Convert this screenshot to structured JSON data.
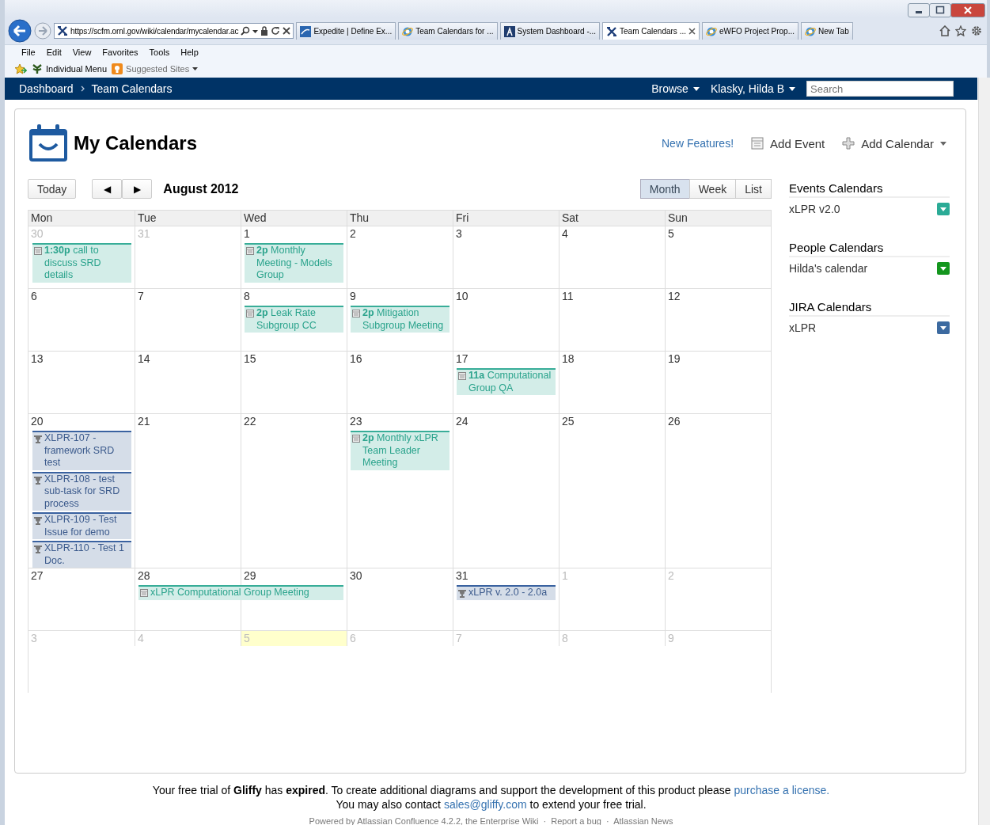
{
  "browser": {
    "address": "https://scfm.ornl.gov/wiki/calendar/mycalendar.ac",
    "tabs": [
      {
        "label": "Expedite | Define Ex...",
        "kind": "site",
        "selected": false
      },
      {
        "label": "Team Calendars for ...",
        "kind": "ie",
        "selected": false
      },
      {
        "label": "System Dashboard -...",
        "kind": "jira",
        "selected": false
      },
      {
        "label": "Team Calendars ...",
        "kind": "tools",
        "selected": true
      },
      {
        "label": "eWFO Project Prop...",
        "kind": "ie",
        "selected": false
      },
      {
        "label": "New Tab",
        "kind": "ie",
        "selected": false
      }
    ],
    "menu": [
      "File",
      "Edit",
      "View",
      "Favorites",
      "Tools",
      "Help"
    ],
    "favorites": [
      {
        "label": "Individual Menu",
        "kind": "leaf"
      },
      {
        "label": "Suggested Sites",
        "kind": "suggested"
      }
    ]
  },
  "nav": {
    "breadcrumbs": [
      "Dashboard",
      "Team Calendars"
    ],
    "browse": "Browse",
    "user": "Klasky, Hilda B",
    "search_placeholder": "Search"
  },
  "header": {
    "title": "My Calendars",
    "new_features": "New Features!",
    "add_event": "Add Event",
    "add_calendar": "Add Calendar"
  },
  "toolbar": {
    "today": "Today",
    "prev": "◀",
    "next": "▶",
    "period": "August 2012",
    "views": [
      {
        "label": "Month",
        "selected": true
      },
      {
        "label": "Week",
        "selected": false
      },
      {
        "label": "List",
        "selected": false
      }
    ]
  },
  "weekdays": [
    "Mon",
    "Tue",
    "Wed",
    "Thu",
    "Fri",
    "Sat",
    "Sun"
  ],
  "weeks": [
    {
      "days": [
        {
          "date": "30",
          "other_month": true,
          "today": false,
          "events": [
            {
              "kind": "event",
              "title": "**1:30p** call to discuss SRD details",
              "continues": false
            }
          ]
        },
        {
          "date": "31",
          "other_month": true,
          "today": false
        },
        {
          "date": "1",
          "other_month": false,
          "today": false,
          "events": [
            {
              "kind": "event",
              "title": "**2p** Monthly Meeting - Models Group",
              "continues": false
            }
          ]
        },
        {
          "date": "2",
          "other_month": false,
          "today": false
        },
        {
          "date": "3",
          "other_month": false,
          "today": false
        },
        {
          "date": "4",
          "other_month": false,
          "today": false
        },
        {
          "date": "5",
          "other_month": false,
          "today": false
        }
      ]
    },
    {
      "days": [
        {
          "date": "6",
          "other_month": false,
          "today": false
        },
        {
          "date": "7",
          "other_month": false,
          "today": false
        },
        {
          "date": "8",
          "other_month": false,
          "today": false,
          "events": [
            {
              "kind": "event",
              "title": "**2p** Leak Rate Subgroup CC",
              "continues": false
            }
          ]
        },
        {
          "date": "9",
          "other_month": false,
          "today": false,
          "events": [
            {
              "kind": "event",
              "title": "**2p** Mitigation Subgroup Meeting",
              "continues": false
            }
          ]
        },
        {
          "date": "10",
          "other_month": false,
          "today": false
        },
        {
          "date": "11",
          "other_month": false,
          "today": false
        },
        {
          "date": "12",
          "other_month": false,
          "today": false
        }
      ]
    },
    {
      "days": [
        {
          "date": "13",
          "other_month": false,
          "today": false
        },
        {
          "date": "14",
          "other_month": false,
          "today": false
        },
        {
          "date": "15",
          "other_month": false,
          "today": false
        },
        {
          "date": "16",
          "other_month": false,
          "today": false
        },
        {
          "date": "17",
          "other_month": false,
          "today": false,
          "events": [
            {
              "kind": "event",
              "title": "**11a** Computational Group QA",
              "continues": false
            }
          ]
        },
        {
          "date": "18",
          "other_month": false,
          "today": false
        },
        {
          "date": "19",
          "other_month": false,
          "today": false
        }
      ]
    },
    {
      "days": [
        {
          "date": "20",
          "other_month": false,
          "today": false,
          "events": [
            {
              "kind": "issue",
              "title": "XLPR-107 - framework SRD test",
              "continues": false
            },
            {
              "kind": "issue",
              "title": "XLPR-108 - test sub-task for SRD process",
              "continues": false
            },
            {
              "kind": "issue",
              "title": "XLPR-109 - Test Issue for demo",
              "continues": false
            },
            {
              "kind": "issue",
              "title": "XLPR-110 - Test 1 Doc.",
              "continues": false
            }
          ]
        },
        {
          "date": "21",
          "other_month": false,
          "today": false
        },
        {
          "date": "22",
          "other_month": false,
          "today": false
        },
        {
          "date": "23",
          "other_month": false,
          "today": false,
          "events": [
            {
              "kind": "event",
              "title": "**2p** Monthly xLPR Team Leader Meeting",
              "continues": false
            }
          ]
        },
        {
          "date": "24",
          "other_month": false,
          "today": false
        },
        {
          "date": "25",
          "other_month": false,
          "today": false
        },
        {
          "date": "26",
          "other_month": false,
          "today": false
        }
      ]
    },
    {
      "days": [
        {
          "date": "27",
          "other_month": false,
          "today": false
        },
        {
          "date": "28",
          "other_month": false,
          "today": false,
          "events": [
            {
              "kind": "event",
              "title": "xLPR Computational Group Meeting",
              "continues": true
            }
          ]
        },
        {
          "date": "29",
          "other_month": false,
          "today": false
        },
        {
          "date": "30",
          "other_month": false,
          "today": false
        },
        {
          "date": "31",
          "other_month": false,
          "today": false,
          "events": [
            {
              "kind": "issue",
              "title": "xLPR v. 2.0 - 2.0a",
              "continues": false
            }
          ]
        },
        {
          "date": "1",
          "other_month": true,
          "today": false
        },
        {
          "date": "2",
          "other_month": true,
          "today": false
        }
      ]
    },
    {
      "days": [
        {
          "date": "3",
          "other_month": true,
          "today": false
        },
        {
          "date": "4",
          "other_month": true,
          "today": false
        },
        {
          "date": "5",
          "other_month": true,
          "today": true
        },
        {
          "date": "6",
          "other_month": true,
          "today": false
        },
        {
          "date": "7",
          "other_month": true,
          "today": false
        },
        {
          "date": "8",
          "other_month": true,
          "today": false
        },
        {
          "date": "9",
          "other_month": true,
          "today": false
        }
      ]
    }
  ],
  "sidebar": [
    {
      "heading": "Events Calendars",
      "calendars": [
        {
          "name": "xLPR v2.0",
          "color": "#2bab96"
        }
      ]
    },
    {
      "heading": "People Calendars",
      "calendars": [
        {
          "name": "Hilda's calendar",
          "color": "#14961e"
        }
      ]
    },
    {
      "heading": "JIRA Calendars",
      "calendars": [
        {
          "name": "xLPR",
          "color": "#3c6aa0"
        }
      ]
    }
  ],
  "footer": {
    "notice": "Your free trial of **Gliffy** has **expired**. To create additional diagrams and support the development of this product please",
    "notice_link": "purchase a license.",
    "contact": "You may also contact",
    "contact_link": "sales@gliffy.com",
    "contact_after": "to extend your free trial.",
    "powered": "Powered by Atlassian Confluence 4.2.2, the Enterprise Wiki  ·  Report a bug  ·  Atlassian News"
  }
}
